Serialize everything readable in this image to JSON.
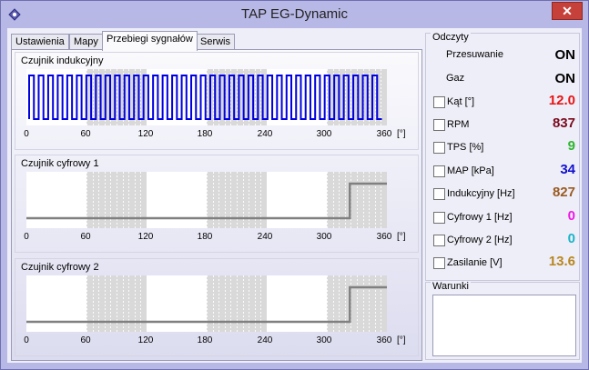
{
  "window": {
    "title": "TAP EG-Dynamic",
    "close_label": "✕"
  },
  "tabs": [
    {
      "label": "Ustawienia"
    },
    {
      "label": "Mapy"
    },
    {
      "label": "Przebiegi sygnałów"
    },
    {
      "label": "Serwis"
    }
  ],
  "charts": [
    {
      "title": "Czujnik indukcyjny"
    },
    {
      "title": "Czujnik cyfrowy 1"
    },
    {
      "title": "Czujnik cyfrowy 2"
    }
  ],
  "axis": {
    "ticks": [
      "0",
      "60",
      "120",
      "180",
      "240",
      "300",
      "360"
    ],
    "unit": "[°]"
  },
  "readings": {
    "title": "Odczyty",
    "items": [
      {
        "label": "Przesuwanie",
        "value": "ON",
        "color": "#000000",
        "checkbox": false
      },
      {
        "label": "Gaz",
        "value": "ON",
        "color": "#000000",
        "checkbox": false
      },
      {
        "label": "Kąt [°]",
        "value": "12.0",
        "color": "#e81414",
        "checkbox": true
      },
      {
        "label": "RPM",
        "value": "837",
        "color": "#7a0a1e",
        "checkbox": true
      },
      {
        "label": "TPS [%]",
        "value": "9",
        "color": "#2fb62f",
        "checkbox": true
      },
      {
        "label": "MAP [kPa]",
        "value": "34",
        "color": "#1010d0",
        "checkbox": true
      },
      {
        "label": "Indukcyjny [Hz]",
        "value": "827",
        "color": "#9a5a22",
        "checkbox": true
      },
      {
        "label": "Cyfrowy 1 [Hz]",
        "value": "0",
        "color": "#f018e8",
        "checkbox": true
      },
      {
        "label": "Cyfrowy 2 [Hz]",
        "value": "0",
        "color": "#1ab4c8",
        "checkbox": true
      },
      {
        "label": "Zasilanie [V]",
        "value": "13.6",
        "color": "#b8861e",
        "checkbox": true
      }
    ]
  },
  "warnings": {
    "title": "Warunki"
  },
  "chart_data": [
    {
      "type": "line",
      "title": "Czujnik indukcyjny",
      "xlabel": "[°]",
      "xlim": [
        0,
        360
      ],
      "shaded_ranges": [
        [
          60,
          120
        ],
        [
          180,
          240
        ],
        [
          300,
          360
        ]
      ],
      "grid": true,
      "series": [
        {
          "signal": "square",
          "pulses": 37,
          "color": "#0000e0",
          "ends_at": 355
        }
      ]
    },
    {
      "type": "line",
      "title": "Czujnik cyfrowy 1",
      "xlabel": "[°]",
      "xlim": [
        0,
        360
      ],
      "shaded_ranges": [
        [
          60,
          120
        ],
        [
          180,
          240
        ],
        [
          300,
          360
        ]
      ],
      "grid": true,
      "series": [
        {
          "x": [
            0,
            323,
            323,
            360
          ],
          "y": [
            0,
            0,
            1,
            1
          ],
          "color": "#808080"
        }
      ]
    },
    {
      "type": "line",
      "title": "Czujnik cyfrowy 2",
      "xlabel": "[°]",
      "xlim": [
        0,
        360
      ],
      "shaded_ranges": [
        [
          60,
          120
        ],
        [
          180,
          240
        ],
        [
          300,
          360
        ]
      ],
      "grid": true,
      "series": [
        {
          "x": [
            0,
            323,
            323,
            360
          ],
          "y": [
            0,
            0,
            1,
            1
          ],
          "color": "#808080"
        }
      ]
    }
  ]
}
